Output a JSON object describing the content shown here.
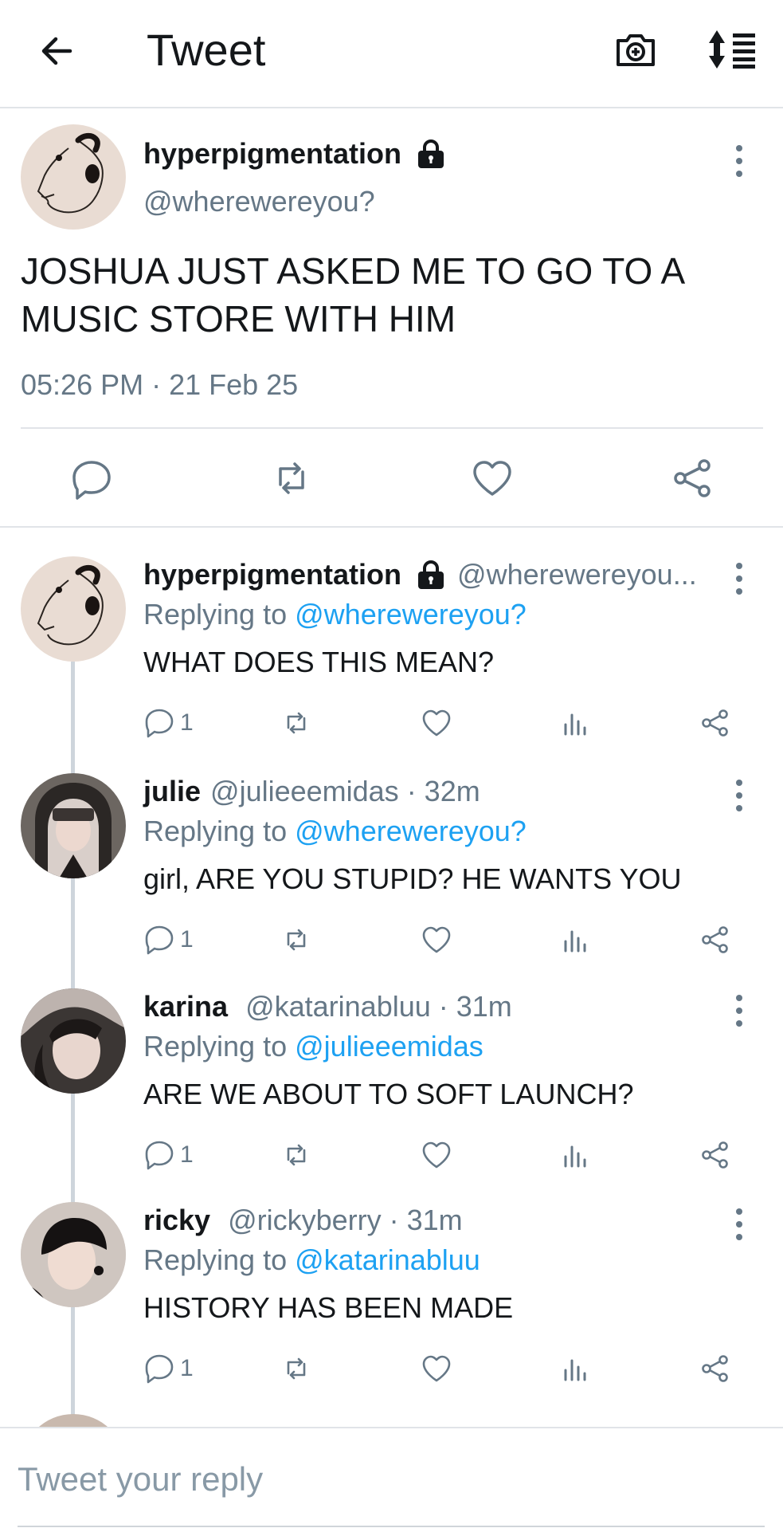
{
  "header": {
    "title": "Tweet",
    "icons": [
      "back-arrow-icon",
      "camera-plus-icon",
      "sort-icon"
    ]
  },
  "main_tweet": {
    "display_name": "hyperpigmentation",
    "handle": "@wherewereyou?",
    "text": "JOSHUA JUST ASKED ME TO GO TO A MUSIC STORE WITH HIM",
    "timestamp": "05:26 PM · 21 Feb 25",
    "protected": true
  },
  "replies": [
    {
      "display_name": "hyperpigmentation",
      "handle": "@wherewereyou...",
      "time": "",
      "protected": true,
      "replying_label": "Replying to",
      "replying_to": "@wherewereyou?",
      "text": "WHAT DOES THIS MEAN?",
      "reply_count": "1"
    },
    {
      "display_name": "julie",
      "handle": "@julieeemidas",
      "time": "· 32m",
      "replying_label": "Replying to",
      "replying_to": "@wherewereyou?",
      "text": "girl, ARE YOU STUPID? HE WANTS YOU",
      "reply_count": "1"
    },
    {
      "display_name": "karina",
      "handle": "@katarinabluu",
      "time": "· 31m",
      "replying_label": "Replying to",
      "replying_to": "@julieeemidas",
      "text": "ARE WE ABOUT TO SOFT LAUNCH?",
      "reply_count": "1"
    },
    {
      "display_name": "ricky",
      "handle": "@rickyberry",
      "time": "· 31m",
      "replying_label": "Replying to",
      "replying_to": "@katarinabluu",
      "text": "HISTORY HAS BEEN MADE",
      "reply_count": "1"
    }
  ],
  "reply_box": {
    "placeholder": "Tweet your reply"
  },
  "colors": {
    "accent": "#1da1f2",
    "secondary_text": "#657786",
    "divider": "#e1e4e8"
  }
}
